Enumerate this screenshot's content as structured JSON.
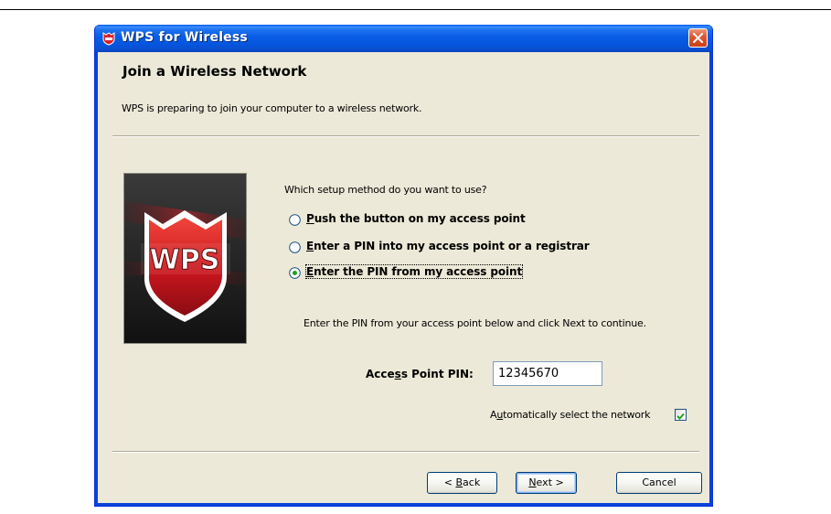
{
  "window": {
    "title": "WPS for Wireless",
    "title_icon": "wps-shield-icon",
    "close_icon": "close-icon"
  },
  "header": {
    "title": "Join a Wireless Network",
    "description": "WPS is preparing to join your computer to a wireless network."
  },
  "logo": {
    "text": "WPS"
  },
  "setup": {
    "question": "Which setup method do you want to use?",
    "options": [
      {
        "label_mnemonic": "P",
        "label_rest": "ush the button on my access point",
        "selected": false
      },
      {
        "label_mnemonic": "E",
        "label_rest": "nter a PIN into my access point or a registrar",
        "selected": false
      },
      {
        "label_mnemonic": "E",
        "label_rest": "nter the PIN from my access point",
        "selected": true
      }
    ]
  },
  "instruction": "Enter the PIN from your access point below and click Next to continue.",
  "pin": {
    "label_pre": "Acce",
    "label_mnemonic": "s",
    "label_post": "s Point PIN:",
    "value": "12345670"
  },
  "auto_select": {
    "label_pre": "A",
    "label_mnemonic": "u",
    "label_post": "tomatically select the network",
    "checked": true
  },
  "buttons": {
    "back_prefix": "< ",
    "back_mnemonic": "B",
    "back_rest": "ack",
    "next_mnemonic": "N",
    "next_rest": "ext >",
    "cancel": "Cancel"
  },
  "colors": {
    "titlebar": "#0a5fe6",
    "dialog_bg": "#ece9d8",
    "close_button": "#de5a34",
    "logo_red": "#d8202a",
    "check_green": "#21a121"
  }
}
